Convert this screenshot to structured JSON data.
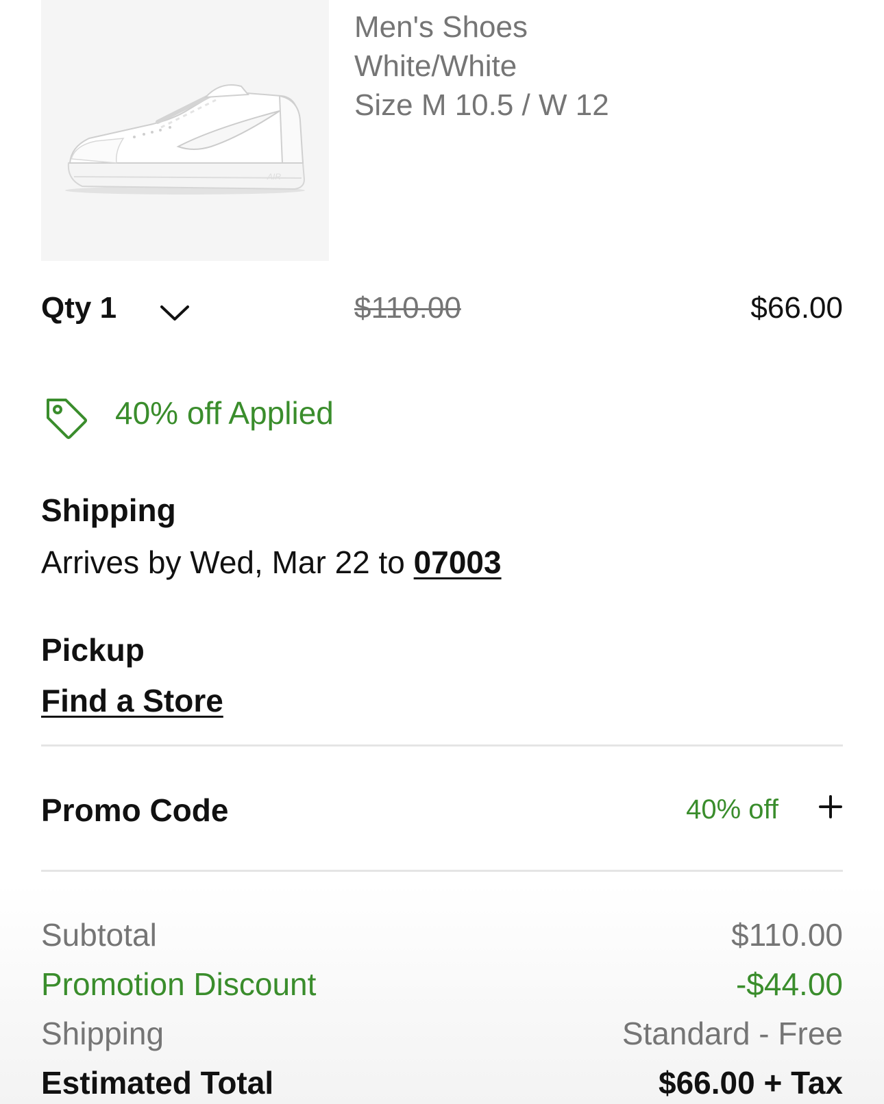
{
  "product": {
    "category": "Men's Shoes",
    "color": "White/White",
    "size": "Size M 10.5 / W 12",
    "image_icon": "white-sneaker-image"
  },
  "quantity": {
    "label": "Qty 1",
    "chevron_icon": "chevron-down-icon"
  },
  "price": {
    "original": "$110.00",
    "current": "$66.00"
  },
  "discount_applied": {
    "text": "40% off Applied",
    "icon": "tag-icon",
    "color": "#3a8d2c"
  },
  "shipping": {
    "title": "Shipping",
    "arrival_prefix": "Arrives by Wed, Mar 22 to ",
    "zip": "07003"
  },
  "pickup": {
    "title": "Pickup",
    "link": "Find a Store"
  },
  "promo_code": {
    "label": "Promo Code",
    "value": "40% off",
    "icon": "plus-icon"
  },
  "summary": {
    "subtotal_label": "Subtotal",
    "subtotal_value": "$110.00",
    "discount_label": "Promotion Discount",
    "discount_value": "-$44.00",
    "shipping_label": "Shipping",
    "shipping_value": "Standard - Free",
    "total_label": "Estimated Total",
    "total_value": "$66.00 + Tax"
  }
}
